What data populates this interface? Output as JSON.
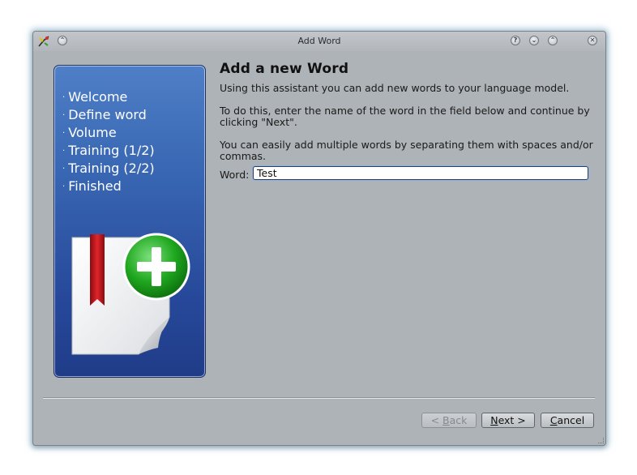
{
  "window": {
    "title": "Add Word"
  },
  "sidebar": {
    "steps": [
      "Welcome",
      "Define word",
      "Volume",
      "Training (1/2)",
      "Training (2/2)",
      "Finished"
    ],
    "bullet": "·"
  },
  "page": {
    "heading": "Add a new Word",
    "intro": "Using this assistant you can add new words to your language model.",
    "instructions": "To do this, enter the name of the word in the field below and continue by clicking \"Next\".",
    "hint": "You can easily add multiple words by separating them with spaces and/or commas.",
    "word_label": "Word:",
    "word_value": "Test"
  },
  "buttons": {
    "back_prefix": "< ",
    "back_accel": "B",
    "back_rest": "ack",
    "next_accel": "N",
    "next_rest": "ext >",
    "cancel_accel": "C",
    "cancel_rest": "ancel"
  },
  "titlebar_buttons": {
    "shade": "⌃",
    "help": "?",
    "minimize": "⌄",
    "maximize": "⌃",
    "close": "✕"
  },
  "colors": {
    "sidebar_top": "#4f7fc7",
    "sidebar_bottom": "#1f3c88",
    "plus_green": "#1fa71f",
    "bookmark_red": "#c8161c"
  }
}
